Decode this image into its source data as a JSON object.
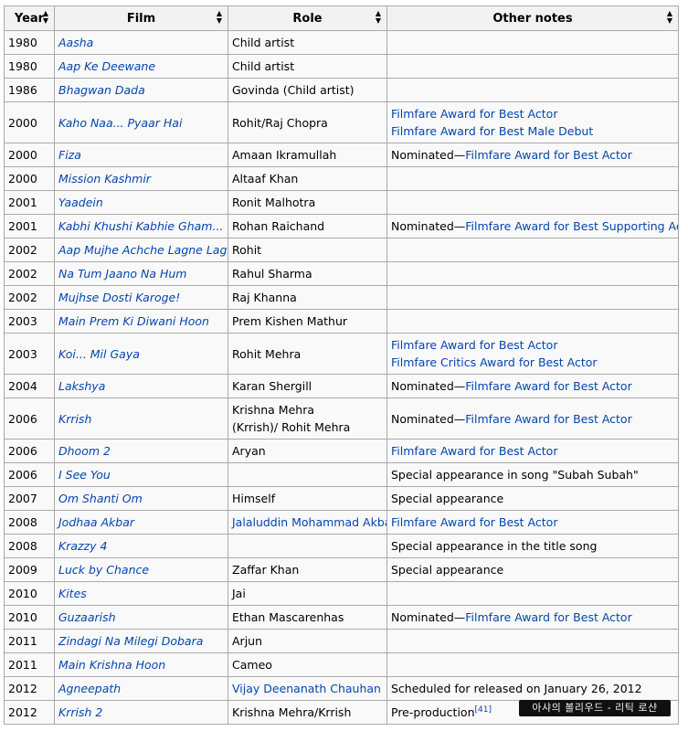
{
  "headers": [
    "Year",
    "Film",
    "Role",
    "Other notes"
  ],
  "rows": [
    {
      "year": "1980",
      "film": "Aasha",
      "role": "Child artist",
      "notes": []
    },
    {
      "year": "1980",
      "film": "Aap Ke Deewane",
      "role": "Child artist",
      "notes": []
    },
    {
      "year": "1986",
      "film": "Bhagwan Dada",
      "role": "Govinda (Child artist)",
      "notes": []
    },
    {
      "year": "2000",
      "film": "Kaho Naa... Pyaar Hai",
      "role": "Rohit/Raj Chopra",
      "notes": [
        {
          "text": "Filmfare Award for Best Actor",
          "link": true
        },
        {
          "text": "Filmfare Award for Best Male Debut",
          "link": true
        }
      ]
    },
    {
      "year": "2000",
      "film": "Fiza",
      "role": "Amaan Ikramullah",
      "notes": [
        {
          "text": "Nominated—",
          "link": false,
          "inline": true
        },
        {
          "text": "Filmfare Award for Best Actor",
          "link": true,
          "inline": true
        }
      ]
    },
    {
      "year": "2000",
      "film": "Mission Kashmir",
      "role": "Altaaf Khan",
      "notes": []
    },
    {
      "year": "2001",
      "film": "Yaadein",
      "role": "Ronit Malhotra",
      "notes": []
    },
    {
      "year": "2001",
      "film": "Kabhi Khushi Kabhie Gham...",
      "role": "Rohan Raichand",
      "notes": [
        {
          "text": "Nominated—",
          "link": false,
          "inline": true
        },
        {
          "text": "Filmfare Award for Best Supporting Actor",
          "link": true,
          "inline": true
        }
      ]
    },
    {
      "year": "2002",
      "film": "Aap Mujhe Achche Lagne Lage",
      "role": "Rohit",
      "notes": []
    },
    {
      "year": "2002",
      "film": "Na Tum Jaano Na Hum",
      "role": "Rahul Sharma",
      "notes": []
    },
    {
      "year": "2002",
      "film": "Mujhse Dosti Karoge!",
      "role": "Raj Khanna",
      "notes": []
    },
    {
      "year": "2003",
      "film": "Main Prem Ki Diwani Hoon",
      "role": "Prem Kishen Mathur",
      "notes": []
    },
    {
      "year": "2003",
      "film": "Koi... Mil Gaya",
      "role": "Rohit Mehra",
      "notes": [
        {
          "text": "Filmfare Award for Best Actor",
          "link": true
        },
        {
          "text": "Filmfare Critics Award for Best Actor",
          "link": true
        }
      ]
    },
    {
      "year": "2004",
      "film": "Lakshya",
      "role": "Karan Shergill",
      "notes": [
        {
          "text": "Nominated—",
          "link": false,
          "inline": true
        },
        {
          "text": "Filmfare Award for Best Actor",
          "link": true,
          "inline": true
        }
      ]
    },
    {
      "year": "2006",
      "film": "Krrish",
      "role": "Krishna Mehra (Krrish)/ Rohit Mehra",
      "role_multiline": true,
      "notes": [
        {
          "text": "Nominated—",
          "link": false,
          "inline": true
        },
        {
          "text": "Filmfare Award for Best Actor",
          "link": true,
          "inline": true
        }
      ]
    },
    {
      "year": "2006",
      "film": "Dhoom 2",
      "role": "Aryan",
      "notes": [
        {
          "text": "Filmfare Award for Best Actor",
          "link": true
        }
      ]
    },
    {
      "year": "2006",
      "film": "I See You",
      "role": "",
      "notes": [
        {
          "text": "Special appearance in song \"Subah Subah\"",
          "link": false
        }
      ]
    },
    {
      "year": "2007",
      "film": "Om Shanti Om",
      "role": "Himself",
      "notes": [
        {
          "text": "Special appearance",
          "link": false
        }
      ]
    },
    {
      "year": "2008",
      "film": "Jodhaa Akbar",
      "role": "Jalaluddin Mohammad Akbar",
      "role_link": true,
      "notes": [
        {
          "text": "Filmfare Award for Best Actor",
          "link": true
        }
      ]
    },
    {
      "year": "2008",
      "film": "Krazzy 4",
      "role": "",
      "notes": [
        {
          "text": "Special appearance in the title song",
          "link": false
        }
      ]
    },
    {
      "year": "2009",
      "film": "Luck by Chance",
      "role": "Zaffar Khan",
      "notes": [
        {
          "text": "Special appearance",
          "link": false
        }
      ]
    },
    {
      "year": "2010",
      "film": "Kites",
      "role": "Jai",
      "notes": []
    },
    {
      "year": "2010",
      "film": "Guzaarish",
      "role": "Ethan Mascarenhas",
      "notes": [
        {
          "text": "Nominated—",
          "link": false,
          "inline": true
        },
        {
          "text": "Filmfare Award for Best Actor",
          "link": true,
          "inline": true
        }
      ]
    },
    {
      "year": "2011",
      "film": "Zindagi Na Milegi Dobara",
      "role": "Arjun",
      "notes": []
    },
    {
      "year": "2011",
      "film": "Main Krishna Hoon",
      "role": "Cameo",
      "notes": []
    },
    {
      "year": "2012",
      "film": "Agneepath",
      "role": "Vijay Deenanath Chauhan",
      "role_link": true,
      "notes": [
        {
          "text": "Scheduled for released on January 26, 2012",
          "link": false
        }
      ]
    },
    {
      "year": "2012",
      "film": "Krrish 2",
      "role": "Krishna Mehra/Krrish",
      "notes": [
        {
          "text": "Pre-production",
          "link": false,
          "inline": true
        },
        {
          "text": "[41]",
          "link": true,
          "inline": true,
          "sup": true
        }
      ]
    }
  ],
  "watermark": "아샤의 볼리우드 - 리틱 로샨"
}
